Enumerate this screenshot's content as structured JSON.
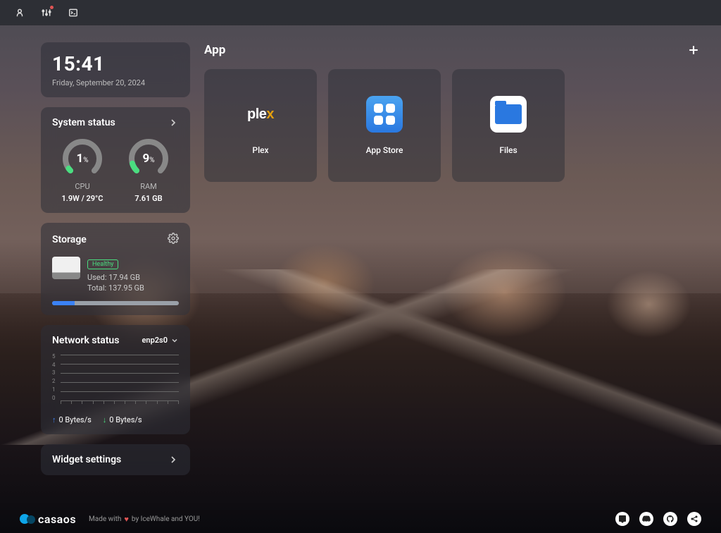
{
  "clock": {
    "time": "15:41",
    "date": "Friday, September 20, 2024"
  },
  "system_status": {
    "title": "System status",
    "cpu": {
      "percent": "1",
      "label": "CPU",
      "sub": "1.9W / 29°C"
    },
    "ram": {
      "percent": "9",
      "label": "RAM",
      "sub": "7.61 GB"
    }
  },
  "storage": {
    "title": "Storage",
    "health": "Healthy",
    "used_label": "Used: 17.94 GB",
    "total_label": "Total: 137.95 GB",
    "fill_percent": 13
  },
  "network": {
    "title": "Network status",
    "interface": "enp2s0",
    "y_ticks": [
      "5",
      "4",
      "3",
      "2",
      "1",
      "0"
    ],
    "up": "0 Bytes/s",
    "down": "0 Bytes/s"
  },
  "widget_settings": {
    "label": "Widget settings"
  },
  "apps_section": {
    "title": "App"
  },
  "apps": [
    {
      "name": "Plex"
    },
    {
      "name": "App Store"
    },
    {
      "name": "Files"
    }
  ],
  "footer": {
    "brand": "casaos",
    "tagline_prefix": "Made with",
    "tagline_suffix": "by IceWhale and YOU!"
  }
}
